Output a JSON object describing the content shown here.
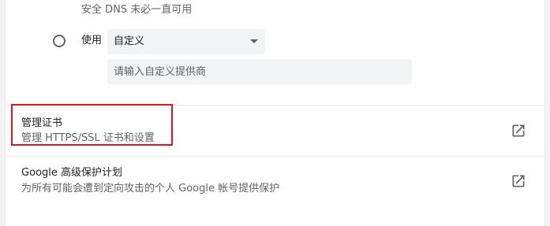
{
  "dns": {
    "hint": "安全 DNS 未必一直可用",
    "use_label": "使用",
    "provider_selected": "自定义",
    "custom_placeholder": "请输入自定义提供商"
  },
  "rows": [
    {
      "title": "管理证书",
      "subtitle": "管理 HTTPS/SSL 证书和设置",
      "icon": "open-in-new-icon"
    },
    {
      "title": "Google 高级保护计划",
      "subtitle": "为所有可能会遭到定向攻击的个人 Google 帐号提供保护",
      "icon": "open-in-new-icon"
    }
  ],
  "colors": {
    "highlight": "#e0141e",
    "text_primary": "#202124",
    "text_secondary": "#5f6368",
    "field_bg": "#f1f3f4"
  }
}
